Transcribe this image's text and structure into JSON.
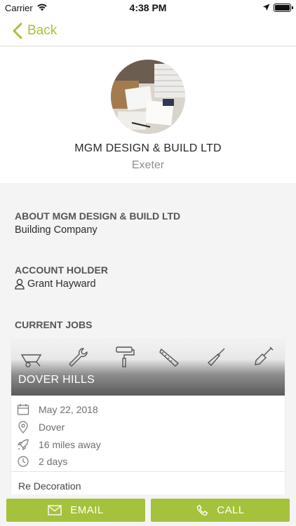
{
  "status_bar": {
    "carrier": "Carrier",
    "time": "4:38 PM"
  },
  "nav": {
    "back_label": "Back"
  },
  "profile": {
    "company_name": "MGM DESIGN & BUILD LTD",
    "city": "Exeter"
  },
  "about": {
    "heading": "ABOUT MGM DESIGN & BUILD LTD",
    "text": "Building Company"
  },
  "account": {
    "heading": "ACCOUNT HOLDER",
    "name": "Grant Hayward"
  },
  "jobs": {
    "heading": "CURRENT JOBS",
    "items": [
      {
        "title": "DOVER HILLS",
        "date": "May 22, 2018",
        "location": "Dover",
        "distance": "16 miles away",
        "duration": "2 days",
        "description": "Re Decoration"
      }
    ]
  },
  "actions": {
    "email_label": "EMAIL",
    "call_label": "CALL"
  },
  "colors": {
    "accent": "#a4c23b",
    "section_bg": "#f4f4f4"
  }
}
